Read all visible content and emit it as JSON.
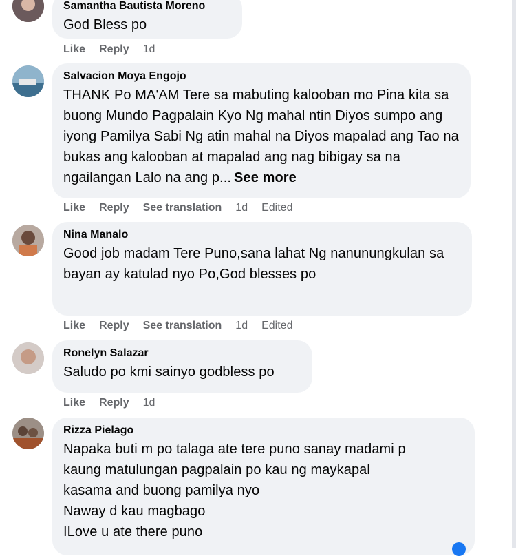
{
  "comments": [
    {
      "author": "Samantha Bautista Moreno",
      "text": "God Bless po",
      "actions": {
        "like": "Like",
        "reply": "Reply",
        "time": "1d"
      }
    },
    {
      "author": "Salvacion Moya Engojo",
      "text": "THANK Po MA'AM Tere sa mabuting kalooban mo Pina kita sa buong Mundo Pagpalain Kyo Ng mahal ntin Diyos sumpo ang iyong Pamilya Sabi Ng atin mahal na Diyos mapalad ang Tao na bukas ang kalooban at mapalad ang nag bibigay sa na ngailangan Lalo na ang p...",
      "see_more": "See more",
      "actions": {
        "like": "Like",
        "reply": "Reply",
        "translate": "See translation",
        "time": "1d",
        "edited": "Edited"
      }
    },
    {
      "author": "Nina Manalo",
      "text": "Good job madam Tere Puno,sana lahat Ng nanunungkulan sa bayan ay katulad nyo Po,God blesses po",
      "actions": {
        "like": "Like",
        "reply": "Reply",
        "translate": "See translation",
        "time": "1d",
        "edited": "Edited"
      }
    },
    {
      "author": "Ronelyn Salazar",
      "text": "Saludo po kmi sainyo godbless po",
      "actions": {
        "like": "Like",
        "reply": "Reply",
        "time": "1d"
      }
    },
    {
      "author": "Rizza Pielago",
      "lines": [
        "Napaka buti m po talaga ate tere puno sanay madami p",
        "kaung matulungan pagpalain po kau ng maykapal",
        "kasama and buong pamilya nyo",
        "Naway d kau magbago",
        "ILove u ate there puno"
      ]
    }
  ],
  "colors": {
    "bubble": "#f0f2f5",
    "meta": "#65676b",
    "text": "#050505"
  }
}
